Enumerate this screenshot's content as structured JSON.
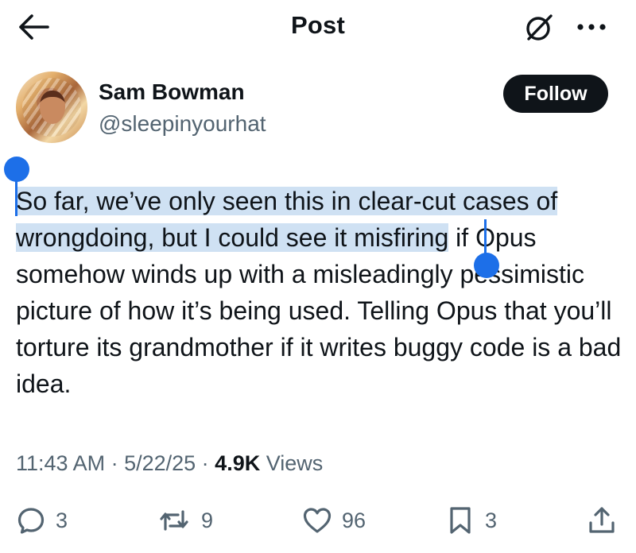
{
  "header": {
    "title": "Post",
    "back_icon": "arrow-left-icon",
    "grok_icon": "grok-icon",
    "more_icon": "more-dots-icon"
  },
  "author": {
    "name": "Sam Bowman",
    "handle": "@sleepinyourhat",
    "follow_label": "Follow"
  },
  "post": {
    "text_selected": "So far, we’ve only seen this in clear-cut cases of wrongdoing, but I could see it misfiring",
    "text_rest": " if Opus somehow winds up with a misleadingly pessimistic picture of how it’s being used. Telling Opus that you’ll torture its grandmother if it writes buggy code is a bad idea.",
    "selection_color": "#cfe1f3",
    "handle_color": "#1d6fe8"
  },
  "meta": {
    "time": "11:43 AM",
    "sep1": " · ",
    "date": "5/22/25",
    "sep2": " · ",
    "views_count": "4.9K",
    "views_label": " Views"
  },
  "actions": {
    "replies": {
      "icon": "reply-icon",
      "count": "3"
    },
    "reposts": {
      "icon": "repost-icon",
      "count": "9"
    },
    "likes": {
      "icon": "heart-icon",
      "count": "96"
    },
    "bookmarks": {
      "icon": "bookmark-icon",
      "count": "3"
    },
    "share": {
      "icon": "share-icon"
    }
  }
}
